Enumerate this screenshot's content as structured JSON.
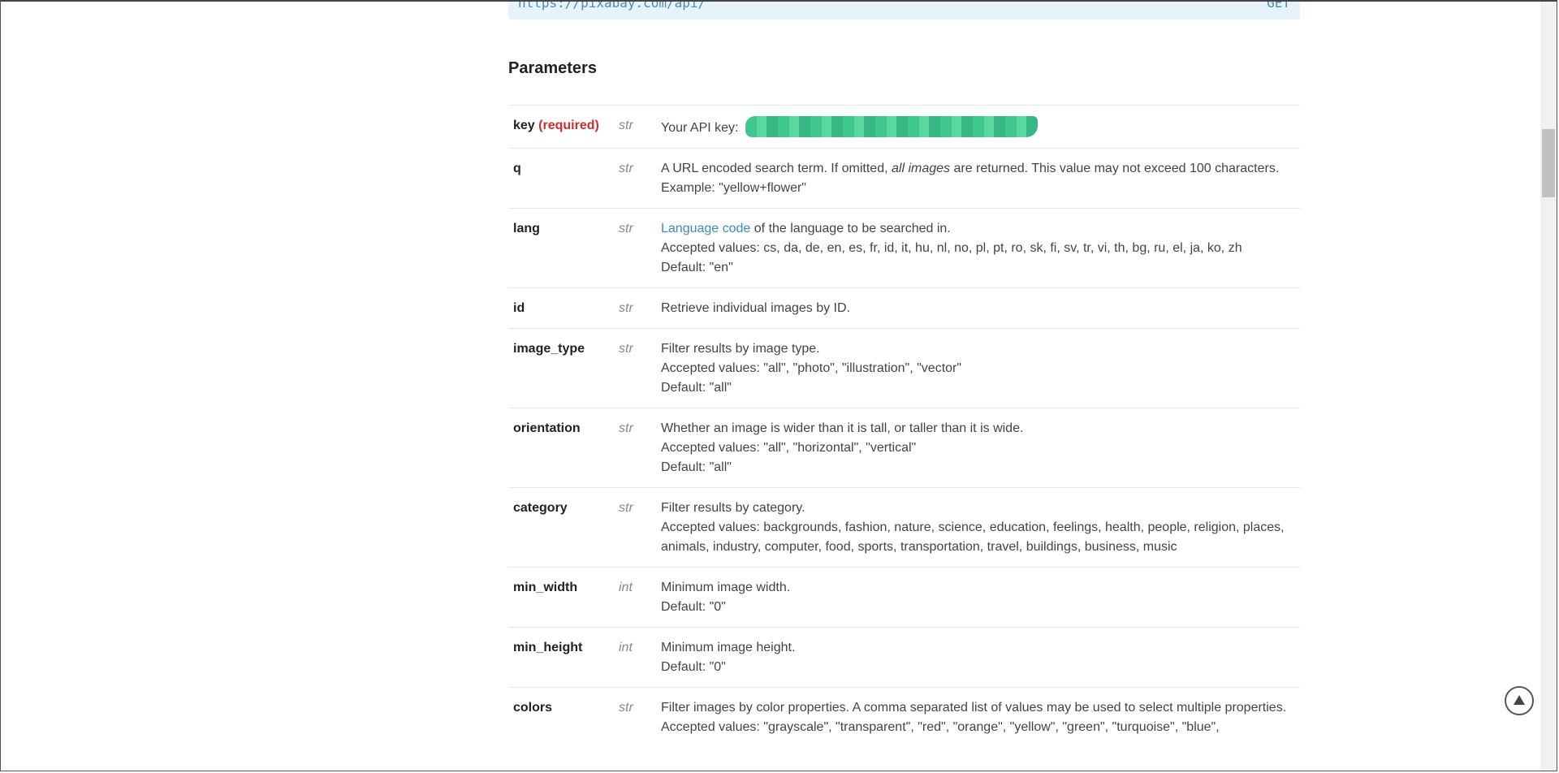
{
  "endpoint": {
    "url": "https://pixabay.com/api/",
    "method": "GET"
  },
  "section_title": "Parameters",
  "params": {
    "key": {
      "name": "key",
      "required_label": "(required)",
      "type": "str",
      "desc_prefix": "Your API key:"
    },
    "q": {
      "name": "q",
      "type": "str",
      "line1_a": "A URL encoded search term. If omitted, ",
      "line1_em": "all images",
      "line1_b": " are returned. This value may not exceed 100 characters.",
      "line2": "Example: \"yellow+flower\""
    },
    "lang": {
      "name": "lang",
      "type": "str",
      "link_text": "Language code",
      "line1_rest": " of the language to be searched in.",
      "line2": "Accepted values: cs, da, de, en, es, fr, id, it, hu, nl, no, pl, pt, ro, sk, fi, sv, tr, vi, th, bg, ru, el, ja, ko, zh",
      "line3": "Default: \"en\""
    },
    "id": {
      "name": "id",
      "type": "str",
      "line1": "Retrieve individual images by ID."
    },
    "image_type": {
      "name": "image_type",
      "type": "str",
      "line1": "Filter results by image type.",
      "line2": "Accepted values: \"all\", \"photo\", \"illustration\", \"vector\"",
      "line3": "Default: \"all\""
    },
    "orientation": {
      "name": "orientation",
      "type": "str",
      "line1": "Whether an image is wider than it is tall, or taller than it is wide.",
      "line2": "Accepted values: \"all\", \"horizontal\", \"vertical\"",
      "line3": "Default: \"all\""
    },
    "category": {
      "name": "category",
      "type": "str",
      "line1": "Filter results by category.",
      "line2": "Accepted values: backgrounds, fashion, nature, science, education, feelings, health, people, religion, places, animals, industry, computer, food, sports, transportation, travel, buildings, business, music"
    },
    "min_width": {
      "name": "min_width",
      "type": "int",
      "line1": "Minimum image width.",
      "line2": "Default: \"0\""
    },
    "min_height": {
      "name": "min_height",
      "type": "int",
      "line1": "Minimum image height.",
      "line2": "Default: \"0\""
    },
    "colors": {
      "name": "colors",
      "type": "str",
      "line1": "Filter images by color properties. A comma separated list of values may be used to select multiple properties.",
      "line2": "Accepted values: \"grayscale\", \"transparent\", \"red\", \"orange\", \"yellow\", \"green\", \"turquoise\", \"blue\","
    }
  },
  "colors": {
    "required": "#c9302c",
    "link": "#3a8ac7",
    "endpoint_bg": "#e7f3fb"
  },
  "icons": {
    "back_to_top": "up-triangle-icon"
  }
}
